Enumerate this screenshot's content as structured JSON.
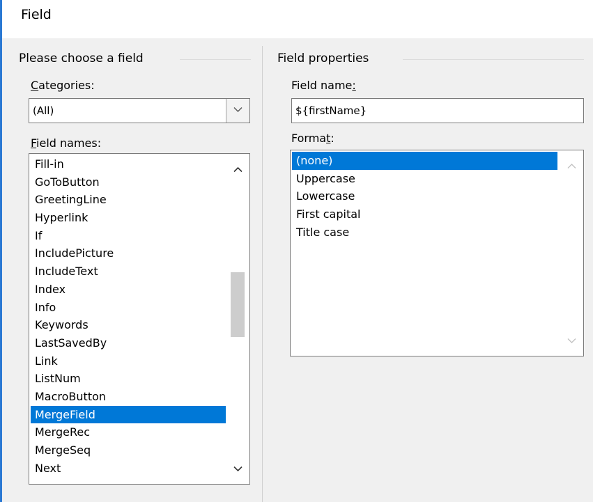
{
  "window": {
    "title": "Field"
  },
  "left_panel": {
    "group_title": "Please choose a field",
    "categories_label_key": "C",
    "categories_label_rest": "ategories:",
    "categories_value": "(All)",
    "field_names_label_key": "F",
    "field_names_label_rest": "ield names:",
    "field_names": [
      "Fill-in",
      "GoToButton",
      "GreetingLine",
      "Hyperlink",
      "If",
      "IncludePicture",
      "IncludeText",
      "Index",
      "Info",
      "Keywords",
      "LastSavedBy",
      "Link",
      "ListNum",
      "MacroButton",
      "MergeField",
      "MergeRec",
      "MergeSeq",
      "Next"
    ],
    "selected_field": "MergeField"
  },
  "right_panel": {
    "group_title": "Field properties",
    "field_name_label_pre": "Field name",
    "field_name_label_key": ":",
    "field_name_value": "${firstName}",
    "format_label_pre": "Forma",
    "format_label_key": "t",
    "format_label_post": ":",
    "formats": [
      "(none)",
      "Uppercase",
      "Lowercase",
      "First capital",
      "Title case"
    ],
    "selected_format": "(none)"
  },
  "icons": {
    "dropdown": "chevron-down-icon",
    "scroll_up": "chevron-up-icon",
    "scroll_down": "chevron-down-icon"
  },
  "colors": {
    "selection": "#0078d7",
    "window_accent": "#2b79d3",
    "dialog_background": "#f0f0f0"
  }
}
